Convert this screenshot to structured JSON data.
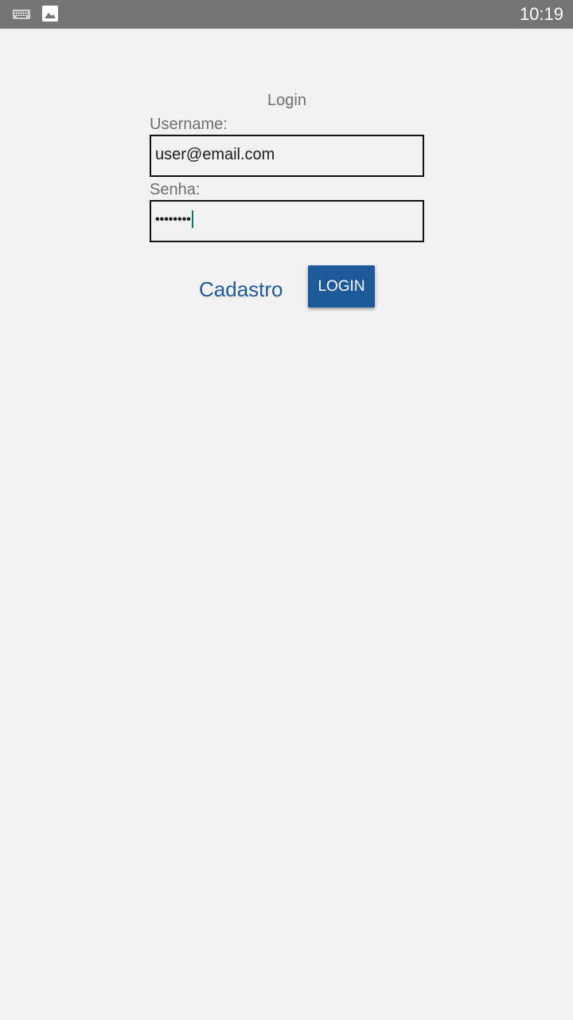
{
  "status_bar": {
    "time": "10:19",
    "left_icons": [
      "keyboard-icon",
      "image-icon"
    ],
    "background_color": "#757575"
  },
  "form": {
    "title": "Login",
    "username": {
      "label": "Username:",
      "value": "user@email.com"
    },
    "password": {
      "label": "Senha:",
      "value": "••••••••"
    }
  },
  "actions": {
    "register_label": "Cadastro",
    "login_label": "LOGIN"
  },
  "colors": {
    "background": "#f2f2f2",
    "accent": "#1e5a99",
    "label_text": "#6f6f6f",
    "cursor": "#00796b"
  }
}
